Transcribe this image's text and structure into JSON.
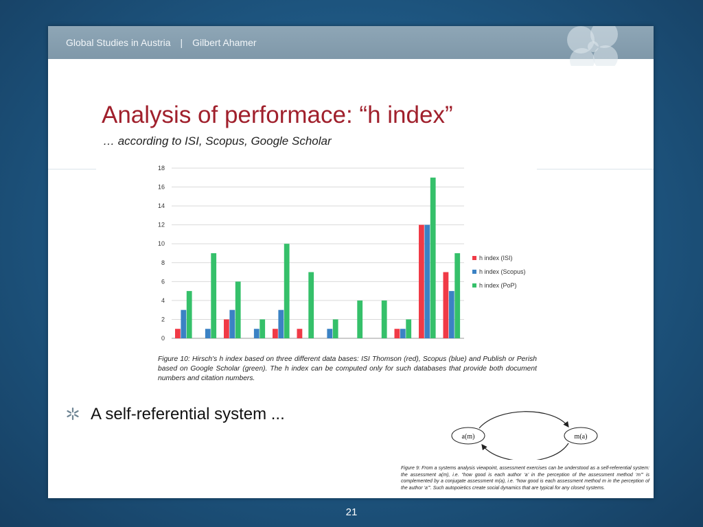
{
  "header": {
    "course": "Global Studies in Austria",
    "separator": "|",
    "author": "Gilbert Ahamer"
  },
  "slide": {
    "title": "Analysis of performace: “h index”",
    "subtitle": "… according to ISI, Scopus, Google Scholar",
    "bullet": "A self-referential system ...",
    "page_number": "21"
  },
  "figure10_caption": "Figure 10: Hirsch's h index based on three different data bases: ISI Thomson (red), Scopus (blue) and Publish or Perish based on Google Scholar (green). The h index can be computed only for such databases that provide both document numbers and citation numbers.",
  "figure9": {
    "node_left": "a(m)",
    "node_right": "m(a)",
    "caption": "Figure 9: From a systems analysis viewpoint, assessment exercises can be understood as a self-referential system: the assessment a(m), i.e. “how good is each author ‘a’ in the perception of the assessment method ‘m’” is complemented by a conjugate assessment m(a), i.e. “how good is each assessment method m in the perception of the author ‘a’”. Such autopoietics create social dynamics that are typical for any closed systems."
  },
  "colors": {
    "isi": "#f03a46",
    "scopus": "#3b82c4",
    "pop": "#35c06a",
    "title": "#a0202c"
  },
  "chart_data": {
    "type": "bar",
    "title": "",
    "xlabel": "",
    "ylabel": "",
    "ylim": [
      0,
      18
    ],
    "yticks": [
      "0",
      "2",
      "4",
      "6",
      "8",
      "10",
      "12",
      "14",
      "16",
      "18"
    ],
    "grid": true,
    "legend_position": "right",
    "categories": [
      "",
      "",
      "",
      "",
      "",
      "",
      "",
      "",
      "",
      "",
      "",
      ""
    ],
    "series": [
      {
        "name": "h index (ISI)",
        "color": "#f03a46",
        "values": [
          1,
          0,
          2,
          0,
          1,
          1,
          0,
          0,
          0,
          1,
          12,
          7
        ]
      },
      {
        "name": "h index (Scopus)",
        "color": "#3b82c4",
        "values": [
          3,
          1,
          3,
          1,
          3,
          0,
          1,
          0,
          0,
          1,
          12,
          5
        ]
      },
      {
        "name": "h index (PoP)",
        "color": "#35c06a",
        "values": [
          5,
          9,
          6,
          2,
          10,
          7,
          2,
          4,
          4,
          2,
          17,
          9
        ]
      }
    ]
  }
}
